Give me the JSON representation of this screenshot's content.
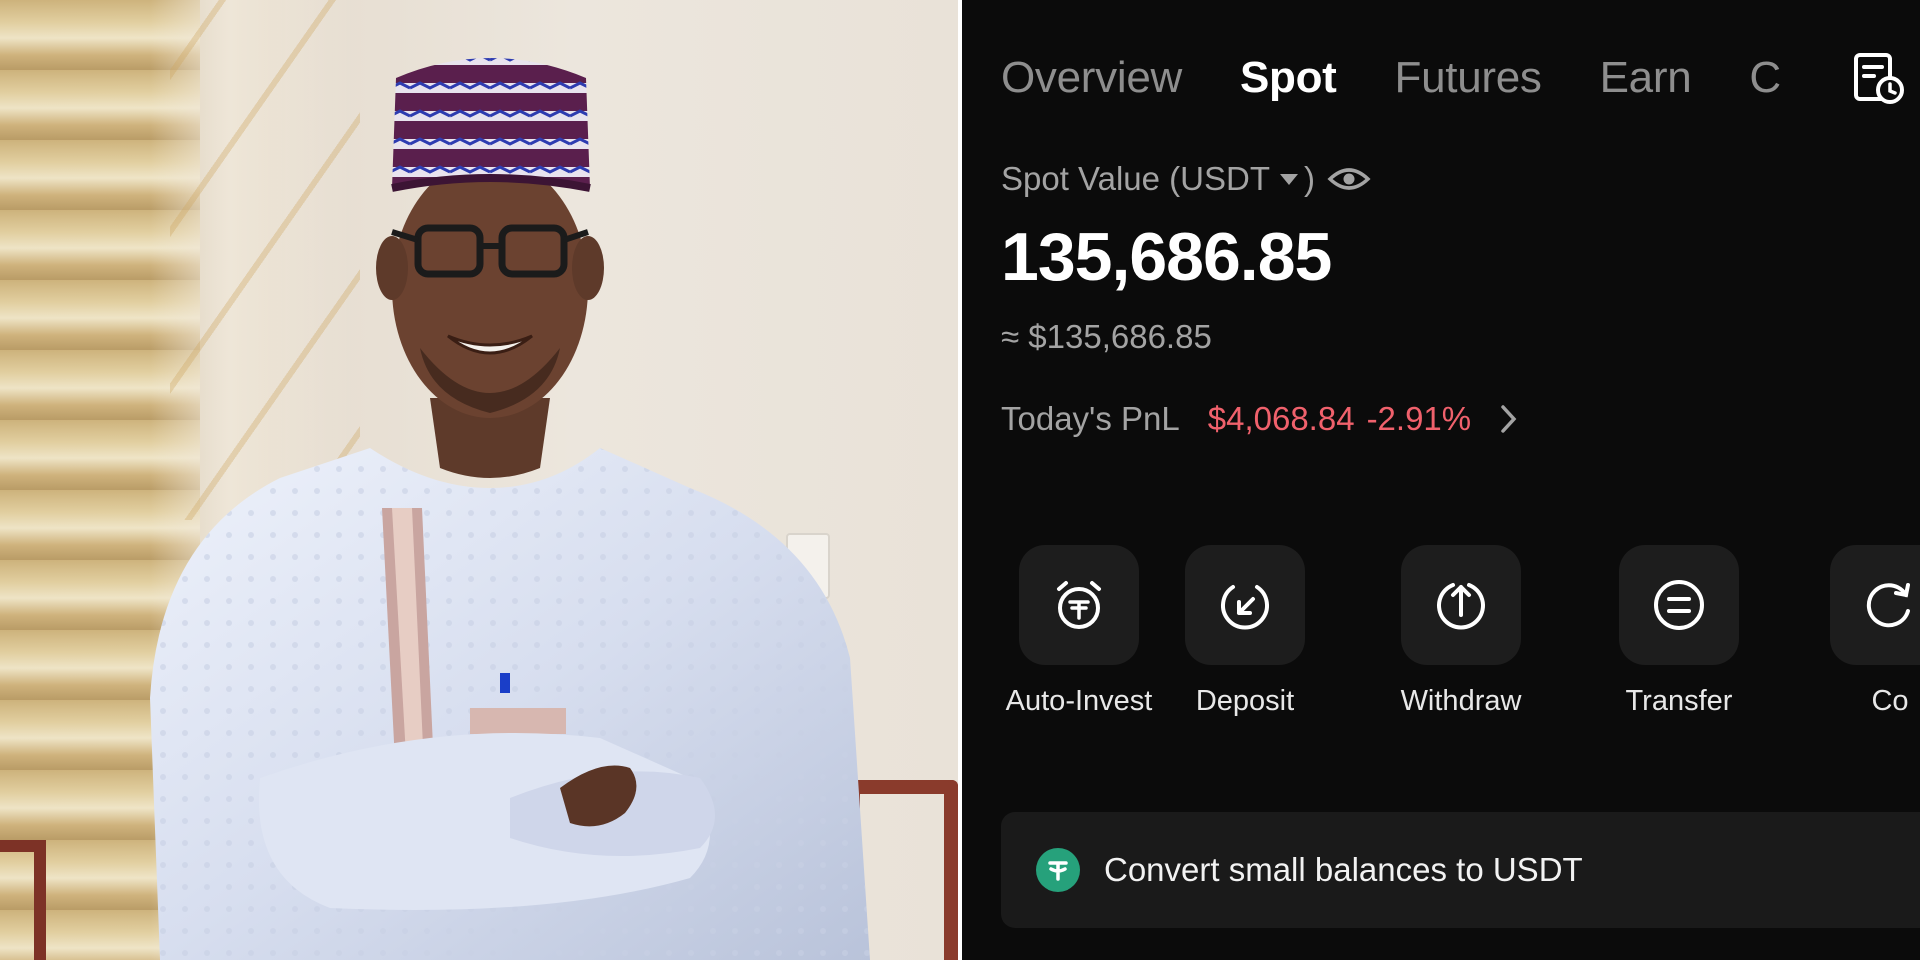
{
  "app": {
    "tabs": [
      {
        "label": "Overview",
        "active": false
      },
      {
        "label": "Spot",
        "active": true
      },
      {
        "label": "Futures",
        "active": false
      },
      {
        "label": "Earn",
        "active": false
      },
      {
        "label": "C",
        "active": false
      }
    ],
    "history_icon": "order-history-icon",
    "spot_value_label": "Spot Value (USDT",
    "spot_value_close": ")",
    "visibility_icon": "eye-icon",
    "balance": "135,686.85",
    "approx_value": "≈ $135,686.85",
    "pnl": {
      "label": "Today's PnL",
      "amount": "$4,068.84",
      "percent": "-2.91%",
      "color": "#f0616c"
    },
    "actions": [
      {
        "label": "Auto-Invest",
        "icon": "auto-invest-clock-icon"
      },
      {
        "label": "Deposit",
        "icon": "deposit-arrow-icon"
      },
      {
        "label": "Withdraw",
        "icon": "withdraw-arrow-icon"
      },
      {
        "label": "Transfer",
        "icon": "transfer-icon"
      },
      {
        "label": "Co",
        "icon": "convert-icon"
      }
    ],
    "convert_banner": {
      "text": "Convert small balances to USDT",
      "icon": "tether-icon",
      "icon_color": "#26a17b"
    }
  },
  "photo": {
    "subject": "portrait-photo"
  }
}
